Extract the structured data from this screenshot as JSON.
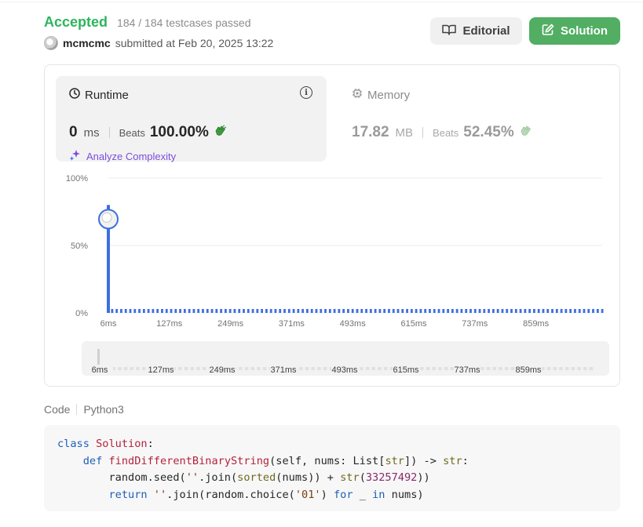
{
  "submission": {
    "status": "Accepted",
    "testcases": "184 / 184 testcases passed",
    "username": "mcmcmc",
    "submitted_text": "submitted at Feb 20, 2025 13:22"
  },
  "buttons": {
    "editorial": "Editorial",
    "solution": "Solution"
  },
  "runtime": {
    "title": "Runtime",
    "value": "0",
    "unit": "ms",
    "beats_label": "Beats",
    "beats_pct": "100.00%",
    "analyze": "Analyze Complexity"
  },
  "memory": {
    "title": "Memory",
    "value": "17.82",
    "unit": "MB",
    "beats_label": "Beats",
    "beats_pct": "52.45%"
  },
  "colors": {
    "accepted": "#2db55d",
    "solution_button": "#51ae63",
    "bar": "#3d6fe0",
    "analyze": "#7c4ddb"
  },
  "chart_data": {
    "type": "bar",
    "y_ticks": [
      "100%",
      "50%",
      "0%"
    ],
    "ylim": [
      0,
      100
    ],
    "x_ticks": [
      "6ms",
      "127ms",
      "249ms",
      "371ms",
      "493ms",
      "615ms",
      "737ms",
      "859ms"
    ],
    "highlight_index": 0,
    "values": [
      80,
      2,
      2,
      2,
      2,
      2,
      2,
      2,
      2,
      2,
      2,
      2,
      2,
      2,
      2,
      2,
      2,
      2,
      2,
      2,
      2,
      2,
      2,
      2,
      2,
      2,
      2,
      2,
      2,
      2,
      2,
      2,
      2,
      2,
      2,
      2,
      2,
      2,
      2,
      2,
      2,
      2,
      2,
      2,
      2,
      2,
      2,
      2,
      2,
      2,
      2,
      2,
      2,
      2,
      2,
      2,
      2,
      2,
      2,
      2,
      2,
      2,
      2,
      2,
      2,
      2,
      2,
      2,
      2,
      2,
      2,
      2,
      2,
      2,
      2,
      2,
      2,
      2,
      2,
      2,
      2,
      2,
      2,
      2,
      2,
      2,
      2,
      2,
      2,
      2,
      2,
      2,
      2,
      2,
      2,
      2,
      2,
      2,
      2,
      2,
      2,
      2,
      2,
      2,
      2,
      2,
      2,
      2,
      2,
      2
    ],
    "grid": true
  },
  "code": {
    "label": "Code",
    "language": "Python3"
  }
}
